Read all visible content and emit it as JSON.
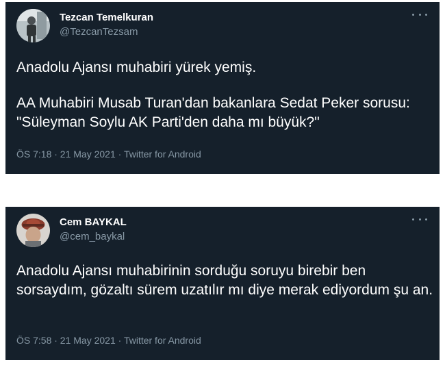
{
  "tweets": [
    {
      "name": "Tezcan Temelkuran",
      "handle": "@TezcanTezsam",
      "avatar": "profile-photo-man-standing",
      "paragraphs": [
        "Anadolu Ajansı muhabiri yürek yemiş.",
        "AA Muhabiri Musab Turan'dan bakanlara Sedat Peker sorusu: \"Süleyman Soylu AK Parti'den daha mı büyük?\""
      ],
      "meta": "ÖS 7:18 · 21 May 2021 · Twitter for Android"
    },
    {
      "name": "Cem BAYKAL",
      "handle": "@cem_baykal",
      "avatar": "profile-photo-hat",
      "paragraphs": [
        "Anadolu Ajansı muhabirinin sorduğu soruyu birebir ben sorsaydım, gözaltı sürem uzatılır mı diye merak ediyordum şu an."
      ],
      "meta": "ÖS 7:58 · 21 May 2021 · Twitter for Android"
    }
  ],
  "colors": {
    "card_background": "#15202b",
    "primary_text": "#ffffff",
    "secondary_text": "#8899a6"
  },
  "icons": {
    "more": "more-horizontal-icon"
  }
}
